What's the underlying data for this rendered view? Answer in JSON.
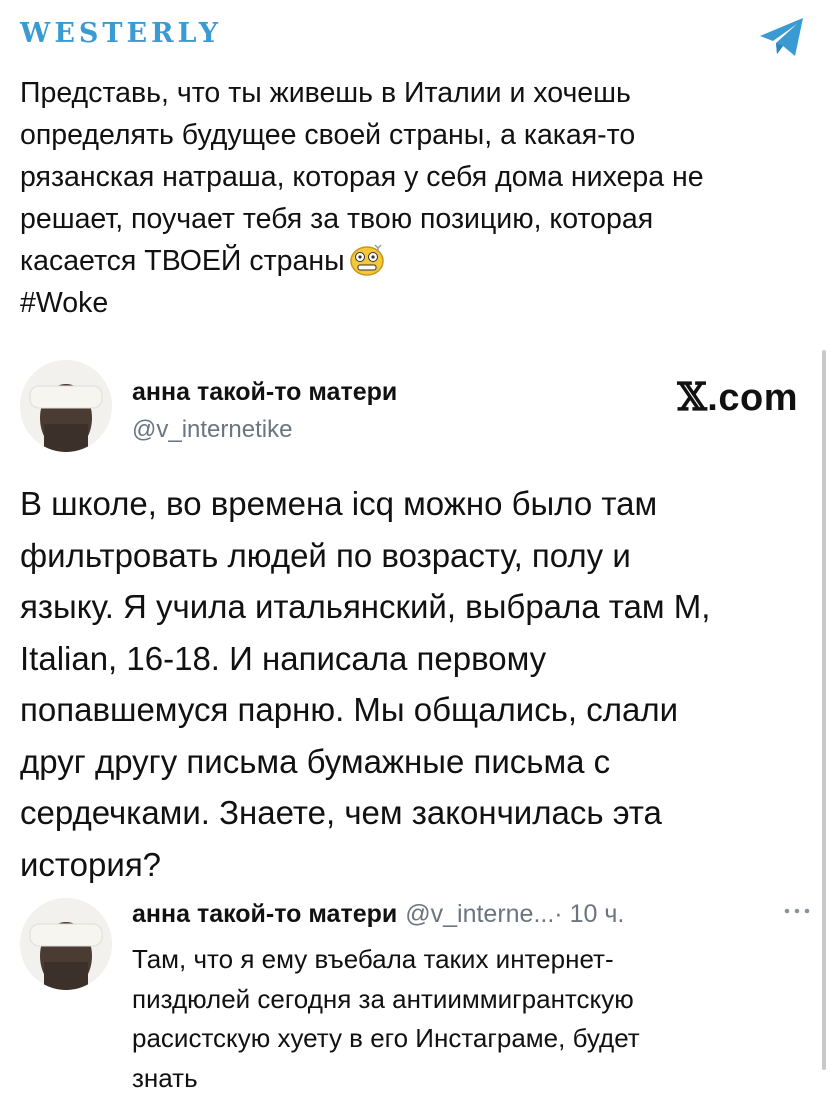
{
  "channel": {
    "name": "WESTERLY",
    "icon": "telegram-icon",
    "accent_color": "#3a9bd3"
  },
  "post": {
    "text_lines": "Представь, что ты живешь в Италии и хочешь\nопределять будущее своей страны, а какая-то\nрязанская натраша, которая у себя дома нихера не\nрешает, поучает тебя за твою позицию, которая\nкасается ТВОЕЙ страны",
    "emoji": "dizzy-face-emoji",
    "hashtag": "#Woke"
  },
  "embedded_tweet": {
    "author_name": "анна такой-то матери",
    "handle": "@v_internetike",
    "source_logo": "𝕏.com",
    "source_x": "𝕏",
    "source_domain": ".com",
    "body": "В школе, во времена icq можно было там\nфильтровать людей по возрасту, полу и\nязыку. Я учила итальянский, выбрала там М,\nItalian, 16-18. И написала первому\nпопавшемуся парню. Мы общались, слали\nдруг другу письма бумажные письма с\nсердечками. Знаете, чем закончилась эта\nистория?"
  },
  "reply": {
    "author_name": "анна такой-то матери",
    "handle": "@v_interne...",
    "time": "· 10 ч.",
    "more_icon": "more-options-icon",
    "body": "Там, что я ему въебала таких интернет-\nпиздюлей сегодня за антииммигрантскую\nрасистскую хуету в его Инстаграме, будет\nзнать"
  }
}
